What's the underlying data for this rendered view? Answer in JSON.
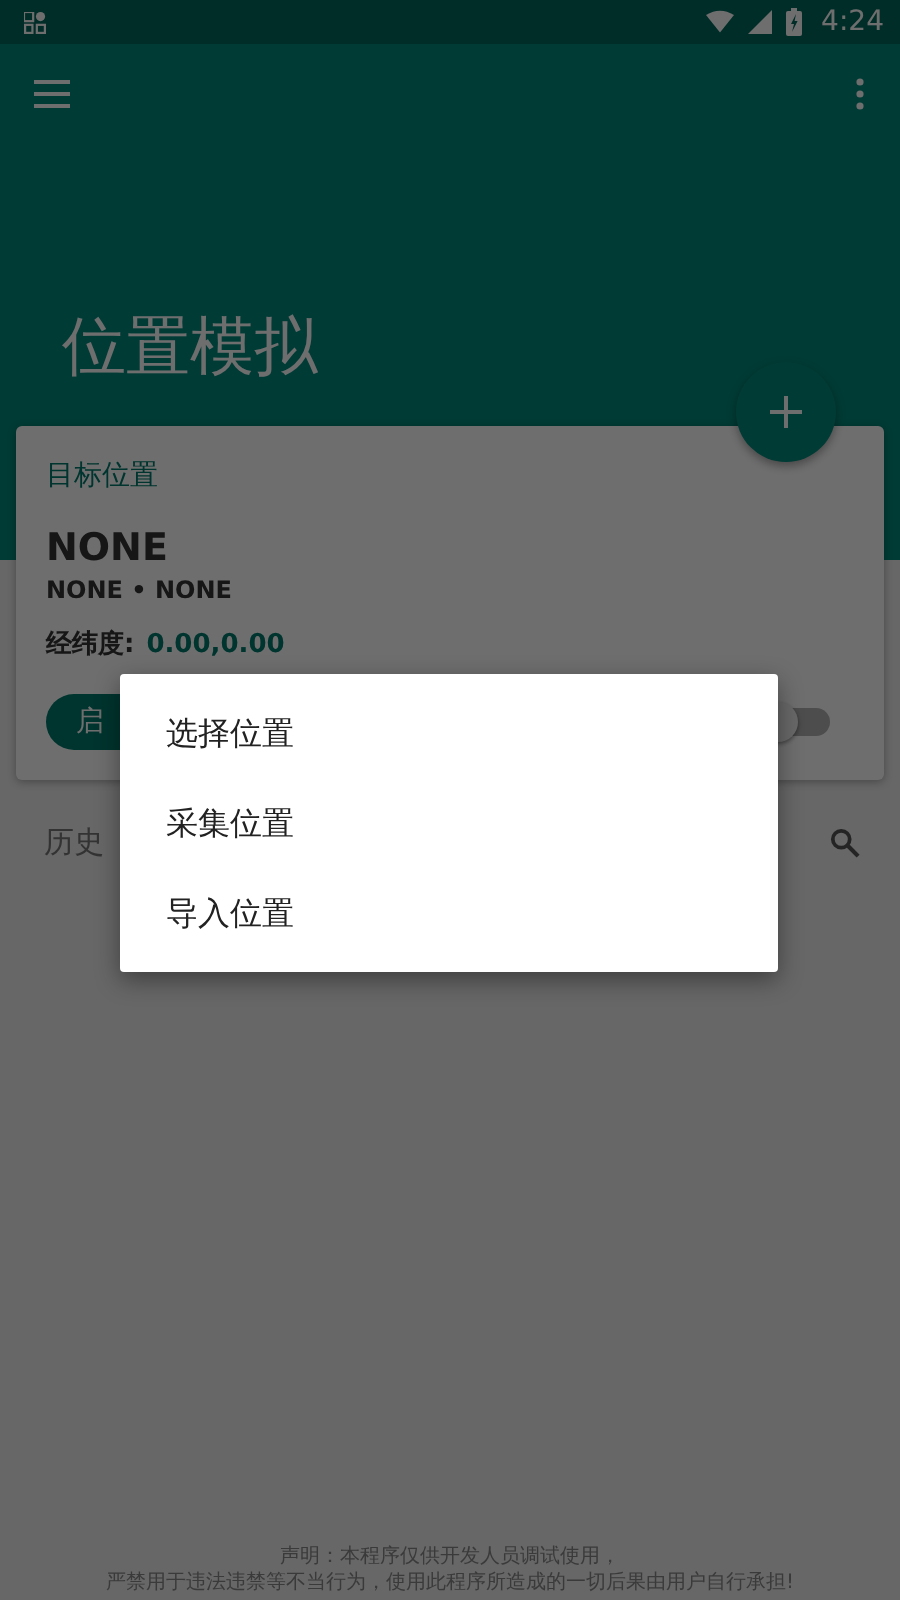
{
  "status_bar": {
    "time": "4:24"
  },
  "header": {
    "title": "位置模拟"
  },
  "target_card": {
    "heading": "目标位置",
    "name": "NONE",
    "subtitle": "NONE • NONE",
    "coord_label": "经纬度:",
    "coord_value": "0.00,0.00",
    "start_button": "启",
    "switch": {
      "on": false
    }
  },
  "history": {
    "label": "历史"
  },
  "footer": {
    "lines": [
      "声明：本程序仅供开发人员调试使用，",
      "严禁用于违法违禁等不当行为，使用此程序所造成的一切后果由用户自行承担!"
    ]
  },
  "menu": {
    "items": [
      {
        "label": "选择位置"
      },
      {
        "label": "采集位置"
      },
      {
        "label": "导入位置"
      }
    ]
  }
}
